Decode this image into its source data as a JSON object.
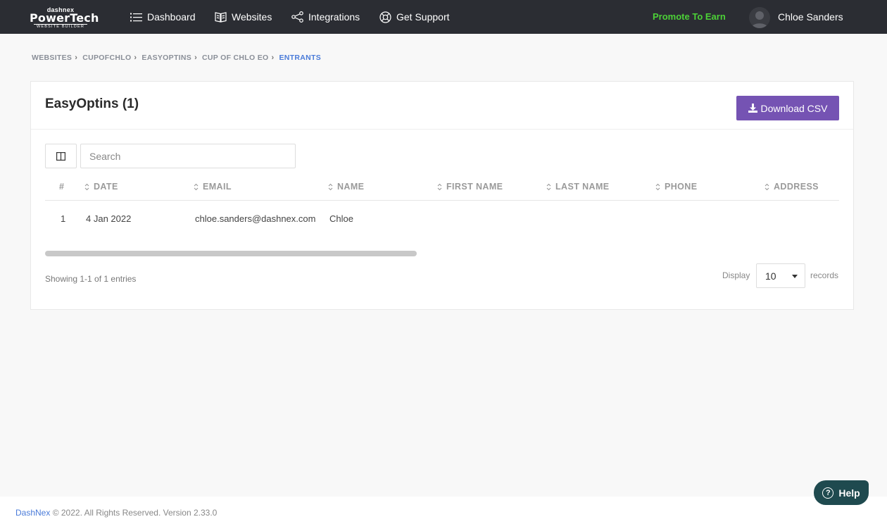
{
  "header": {
    "logo_top": "dashnex",
    "logo_main": "PowerTech",
    "logo_tag": "WEBSITE BUILDER",
    "nav": [
      {
        "label": "Dashboard",
        "icon": "list-icon"
      },
      {
        "label": "Websites",
        "icon": "book-icon"
      },
      {
        "label": "Integrations",
        "icon": "share-icon"
      },
      {
        "label": "Get Support",
        "icon": "lifebuoy-icon"
      }
    ],
    "promote": "Promote To Earn",
    "user_name": "Chloe Sanders"
  },
  "breadcrumb": [
    "WEBSITES",
    "CUPOFCHLO",
    "EASYOPTINS",
    "CUP OF CHLO EO",
    "ENTRANTS"
  ],
  "card": {
    "title": "EasyOptins (1)",
    "download_label": "Download CSV",
    "search_placeholder": "Search"
  },
  "table": {
    "columns": [
      "#",
      "DATE",
      "EMAIL",
      "NAME",
      "FIRST NAME",
      "LAST NAME",
      "PHONE",
      "ADDRESS"
    ],
    "rows": [
      [
        "1",
        "4 Jan 2022",
        "chloe.sanders@dashnex.com",
        "Chloe",
        "",
        "",
        "",
        ""
      ]
    ]
  },
  "pagination": {
    "showing": "Showing 1-1 of 1 entries",
    "display_label": "Display",
    "per_page": "10",
    "records_label": "records"
  },
  "footer": {
    "brand": "DashNex",
    "text": " © 2022. All Rights Reserved. Version 2.33.0"
  },
  "help": {
    "label": "Help"
  },
  "colors": {
    "topbar": "#2b2d33",
    "promote": "#4cd137",
    "button": "#7553b3",
    "link": "#4a7bd9",
    "help": "#1f4a4f"
  }
}
